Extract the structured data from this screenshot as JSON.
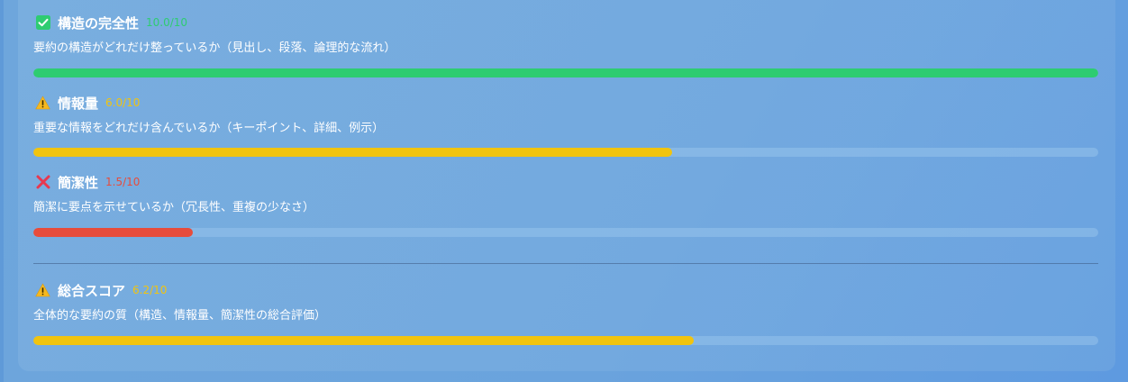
{
  "metrics": [
    {
      "title": "構造の完全性",
      "score": "10.0/10",
      "value": 10.0,
      "max": 10,
      "description": "要約の構造がどれだけ整っているか（見出し、段落、論理的な流れ）",
      "status": "good",
      "icon": "check-icon",
      "color": "#2ecc71"
    },
    {
      "title": "情報量",
      "score": "6.0/10",
      "value": 6.0,
      "max": 10,
      "description": "重要な情報をどれだけ含んでいるか（キーポイント、詳細、例示）",
      "status": "warning",
      "icon": "warning-icon",
      "color": "#f1c40f"
    },
    {
      "title": "簡潔性",
      "score": "1.5/10",
      "value": 1.5,
      "max": 10,
      "description": "簡潔に要点を示せているか（冗長性、重複の少なさ）",
      "status": "bad",
      "icon": "cross-icon",
      "color": "#e74c3c"
    }
  ],
  "overall": {
    "title": "総合スコア",
    "score": "6.2/10",
    "value": 6.2,
    "max": 10,
    "description": "全体的な要約の質（構造、情報量、簡潔性の総合評価）",
    "status": "warning",
    "icon": "warning-icon",
    "color": "#f1c40f"
  },
  "score_colors": {
    "good": "#2ecc71",
    "warning": "#f1c40f",
    "bad": "#e74c3c"
  }
}
